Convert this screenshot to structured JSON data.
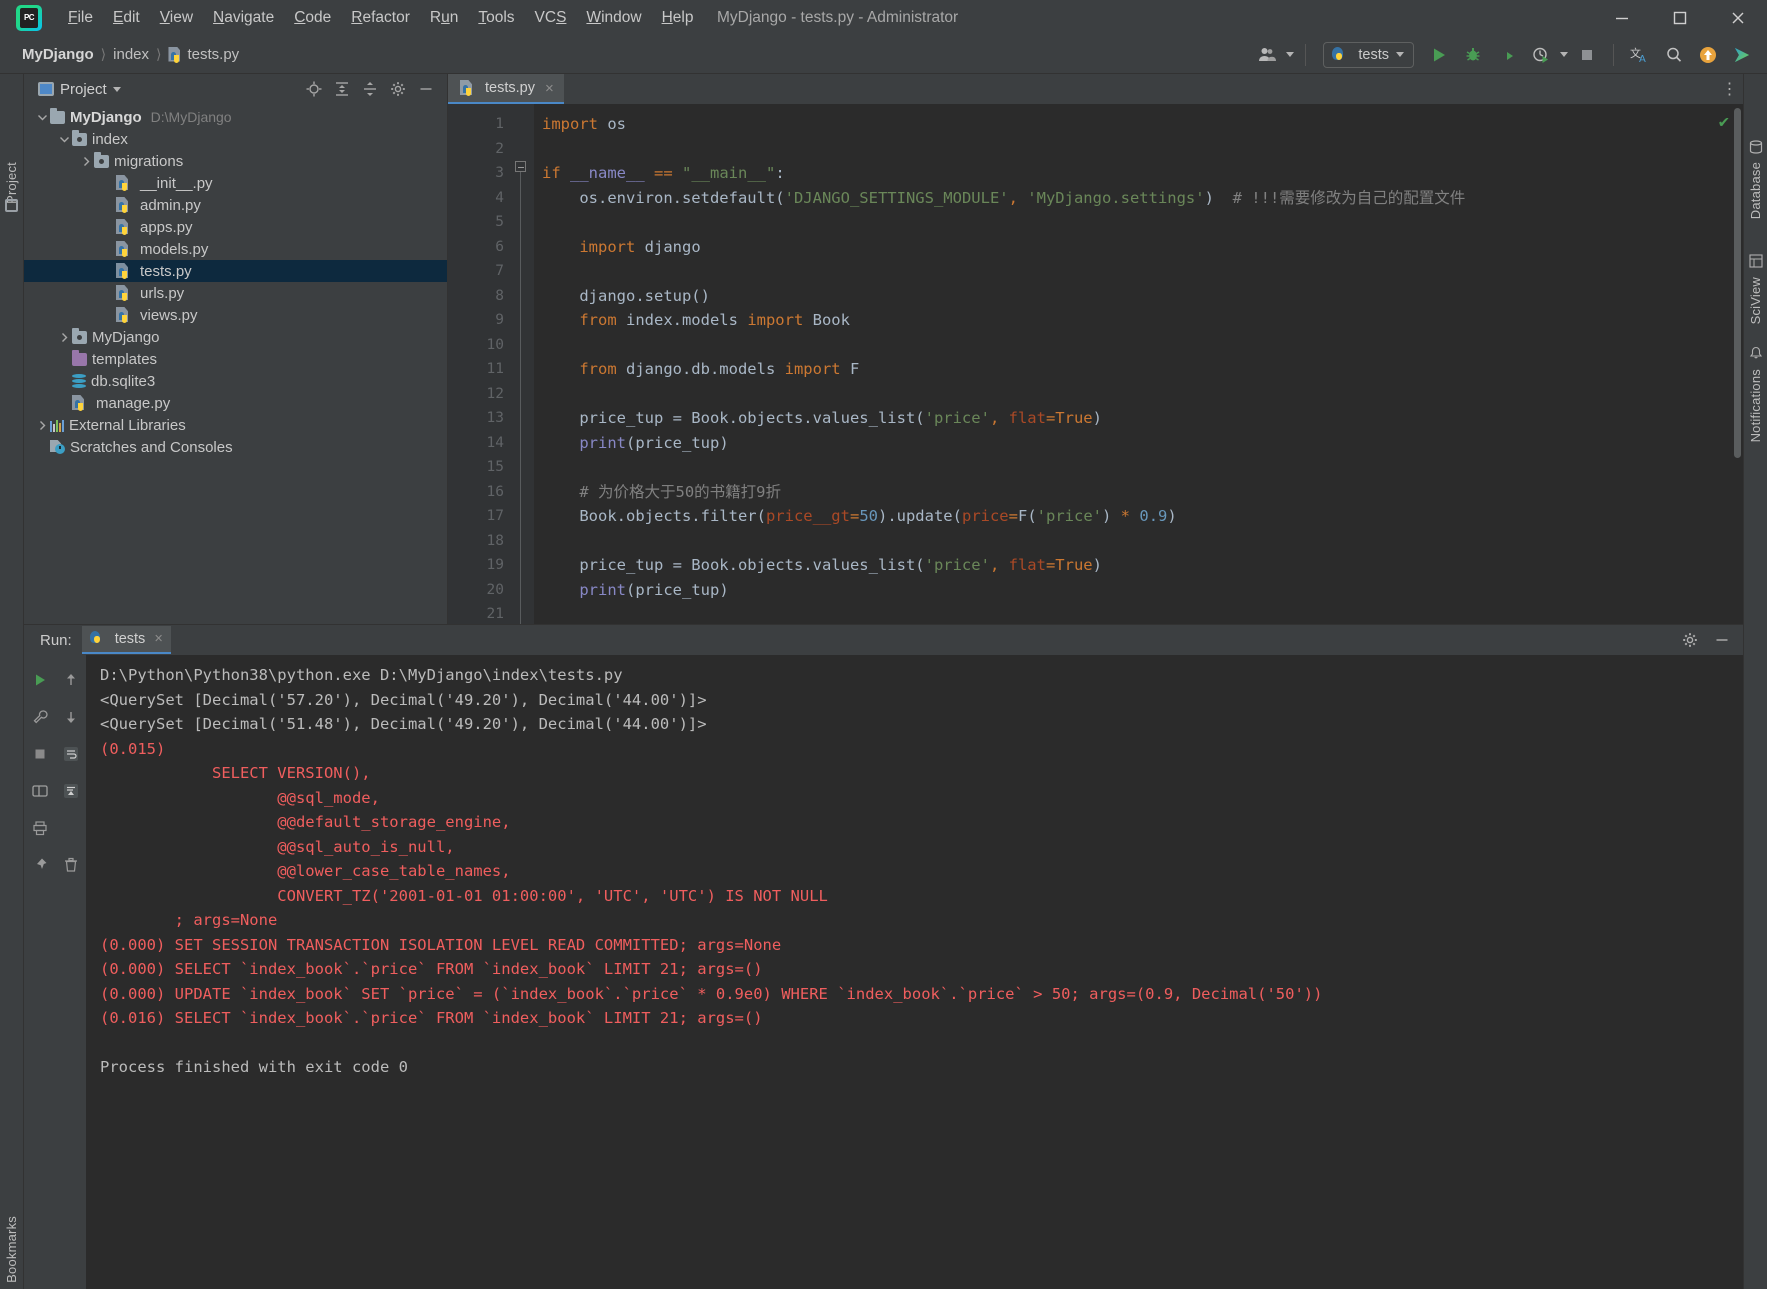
{
  "window": {
    "title": "MyDjango - tests.py - Administrator",
    "minimize": "minimize-icon",
    "maximize": "maximize-icon",
    "close": "close-icon"
  },
  "menu": {
    "logo_text": "PC",
    "items": [
      {
        "label": "File",
        "mnemonic": "F"
      },
      {
        "label": "Edit",
        "mnemonic": "E"
      },
      {
        "label": "View",
        "mnemonic": "V"
      },
      {
        "label": "Navigate",
        "mnemonic": "N"
      },
      {
        "label": "Code",
        "mnemonic": "C"
      },
      {
        "label": "Refactor",
        "mnemonic": "R"
      },
      {
        "label": "Run",
        "mnemonic": "u"
      },
      {
        "label": "Tools",
        "mnemonic": "T"
      },
      {
        "label": "VCS",
        "mnemonic": "S"
      },
      {
        "label": "Window",
        "mnemonic": "W"
      },
      {
        "label": "Help",
        "mnemonic": "H"
      }
    ]
  },
  "breadcrumbs": [
    {
      "label": "MyDjango",
      "bold": true,
      "icon": null
    },
    {
      "label": "index",
      "bold": false,
      "icon": null
    },
    {
      "label": "tests.py",
      "bold": false,
      "icon": "python-file-icon"
    }
  ],
  "toolbar": {
    "user_icon": "user-avatar-icon",
    "run_config_name": "tests",
    "run_config_icon": "python-icon",
    "run_label": "run-icon",
    "debug_label": "debug-icon",
    "coverage_label": "run-with-coverage-icon",
    "profile_label": "profile-icon",
    "stop_label": "stop-icon",
    "translate_label": "translate-icon",
    "search_label": "search-icon",
    "update_label": "update-icon",
    "play_label": "play-brand-icon"
  },
  "rails": {
    "left": [
      "Project",
      "Bookmarks"
    ],
    "right": [
      "Database",
      "SciView",
      "Notifications"
    ]
  },
  "project_panel": {
    "title": "Project",
    "tools": [
      "locate-icon",
      "expand-all-icon",
      "collapse-all-icon",
      "settings-icon",
      "hide-icon"
    ],
    "tree": [
      {
        "label": "MyDjango",
        "path": "D:\\MyDjango",
        "indent": 0,
        "icon": "folder-icon",
        "arrow": "down",
        "bold": true,
        "selected": false
      },
      {
        "label": "index",
        "path": "",
        "indent": 1,
        "icon": "module-folder-icon",
        "arrow": "down",
        "bold": false,
        "selected": false
      },
      {
        "label": "migrations",
        "path": "",
        "indent": 2,
        "icon": "module-folder-icon",
        "arrow": "right",
        "bold": false,
        "selected": false
      },
      {
        "label": "__init__.py",
        "path": "",
        "indent": 3,
        "icon": "python-file-icon",
        "arrow": "none",
        "bold": false,
        "selected": false
      },
      {
        "label": "admin.py",
        "path": "",
        "indent": 3,
        "icon": "python-file-icon",
        "arrow": "none",
        "bold": false,
        "selected": false
      },
      {
        "label": "apps.py",
        "path": "",
        "indent": 3,
        "icon": "python-file-icon",
        "arrow": "none",
        "bold": false,
        "selected": false
      },
      {
        "label": "models.py",
        "path": "",
        "indent": 3,
        "icon": "python-file-icon",
        "arrow": "none",
        "bold": false,
        "selected": false
      },
      {
        "label": "tests.py",
        "path": "",
        "indent": 3,
        "icon": "python-file-icon",
        "arrow": "none",
        "bold": false,
        "selected": true
      },
      {
        "label": "urls.py",
        "path": "",
        "indent": 3,
        "icon": "python-file-icon",
        "arrow": "none",
        "bold": false,
        "selected": false
      },
      {
        "label": "views.py",
        "path": "",
        "indent": 3,
        "icon": "python-file-icon",
        "arrow": "none",
        "bold": false,
        "selected": false
      },
      {
        "label": "MyDjango",
        "path": "",
        "indent": 1,
        "icon": "module-folder-icon",
        "arrow": "right",
        "bold": false,
        "selected": false
      },
      {
        "label": "templates",
        "path": "",
        "indent": 1,
        "icon": "templates-folder-icon",
        "arrow": "none",
        "bold": false,
        "selected": false
      },
      {
        "label": "db.sqlite3",
        "path": "",
        "indent": 1,
        "icon": "database-file-icon",
        "arrow": "none",
        "bold": false,
        "selected": false
      },
      {
        "label": "manage.py",
        "path": "",
        "indent": 1,
        "icon": "python-file-icon",
        "arrow": "none",
        "bold": false,
        "selected": false
      },
      {
        "label": "External Libraries",
        "path": "",
        "indent": 0,
        "icon": "libraries-icon",
        "arrow": "right",
        "bold": false,
        "selected": false
      },
      {
        "label": "Scratches and Consoles",
        "path": "",
        "indent": 0,
        "icon": "scratches-icon",
        "arrow": "none",
        "bold": false,
        "selected": false
      }
    ]
  },
  "editor": {
    "tabs": [
      {
        "label": "tests.py",
        "icon": "python-file-icon",
        "close": "×",
        "active": true
      }
    ],
    "more_icon": "more-options-icon",
    "inspection_status": "✔",
    "line_numbers": [
      "1",
      "2",
      "3",
      "4",
      "5",
      "6",
      "7",
      "8",
      "9",
      "10",
      "11",
      "12",
      "13",
      "14",
      "15",
      "16",
      "17",
      "18",
      "19",
      "20",
      "21"
    ],
    "lines": [
      {
        "n": 1,
        "tokens": [
          {
            "t": "import",
            "c": "kw"
          },
          {
            "t": " os",
            "c": "fn"
          }
        ]
      },
      {
        "n": 2,
        "tokens": []
      },
      {
        "n": 3,
        "tokens": [
          {
            "t": "if",
            "c": "kw"
          },
          {
            "t": " __name__ ",
            "c": "bi"
          },
          {
            "t": "==",
            "c": "kw"
          },
          {
            "t": " ",
            "c": "fn"
          },
          {
            "t": "\"__main__\"",
            "c": "str"
          },
          {
            "t": ":",
            "c": "fn"
          }
        ]
      },
      {
        "n": 4,
        "tokens": [
          {
            "t": "    os.environ.setdefault(",
            "c": "fn"
          },
          {
            "t": "'DJANGO_SETTINGS_MODULE'",
            "c": "str"
          },
          {
            "t": ",",
            "c": "kw"
          },
          {
            "t": " ",
            "c": "fn"
          },
          {
            "t": "'MyDjango.settings'",
            "c": "str"
          },
          {
            "t": ")",
            "c": "fn"
          },
          {
            "t": "  # !!!需要修改为自己的配置文件",
            "c": "cmt"
          }
        ]
      },
      {
        "n": 5,
        "tokens": []
      },
      {
        "n": 6,
        "tokens": [
          {
            "t": "    ",
            "c": "fn"
          },
          {
            "t": "import",
            "c": "kw"
          },
          {
            "t": " django",
            "c": "fn"
          }
        ]
      },
      {
        "n": 7,
        "tokens": []
      },
      {
        "n": 8,
        "tokens": [
          {
            "t": "    django.setup()",
            "c": "fn"
          }
        ]
      },
      {
        "n": 9,
        "tokens": [
          {
            "t": "    ",
            "c": "fn"
          },
          {
            "t": "from",
            "c": "kw"
          },
          {
            "t": " index.models ",
            "c": "fn"
          },
          {
            "t": "import",
            "c": "kw"
          },
          {
            "t": " Book",
            "c": "fn"
          }
        ]
      },
      {
        "n": 10,
        "tokens": []
      },
      {
        "n": 11,
        "tokens": [
          {
            "t": "    ",
            "c": "fn"
          },
          {
            "t": "from",
            "c": "kw"
          },
          {
            "t": " django.db.models ",
            "c": "fn"
          },
          {
            "t": "import",
            "c": "kw"
          },
          {
            "t": " F",
            "c": "fn"
          }
        ]
      },
      {
        "n": 12,
        "tokens": []
      },
      {
        "n": 13,
        "tokens": [
          {
            "t": "    price_tup = Book.objects.values_list(",
            "c": "fn"
          },
          {
            "t": "'price'",
            "c": "str"
          },
          {
            "t": ",",
            "c": "kw"
          },
          {
            "t": " ",
            "c": "fn"
          },
          {
            "t": "flat",
            "c": "param"
          },
          {
            "t": "=",
            "c": "kw"
          },
          {
            "t": "True",
            "c": "kw"
          },
          {
            "t": ")",
            "c": "fn"
          }
        ]
      },
      {
        "n": 14,
        "tokens": [
          {
            "t": "    ",
            "c": "fn"
          },
          {
            "t": "print",
            "c": "bi"
          },
          {
            "t": "(price_tup)",
            "c": "fn"
          }
        ]
      },
      {
        "n": 15,
        "tokens": []
      },
      {
        "n": 16,
        "tokens": [
          {
            "t": "    # 为价格大于50的书籍打9折",
            "c": "cmt"
          }
        ]
      },
      {
        "n": 17,
        "tokens": [
          {
            "t": "    Book.objects.filter(",
            "c": "fn"
          },
          {
            "t": "price__gt",
            "c": "param"
          },
          {
            "t": "=",
            "c": "kw"
          },
          {
            "t": "50",
            "c": "num"
          },
          {
            "t": ").update(",
            "c": "fn"
          },
          {
            "t": "price",
            "c": "param"
          },
          {
            "t": "=",
            "c": "kw"
          },
          {
            "t": "F(",
            "c": "fn"
          },
          {
            "t": "'price'",
            "c": "str"
          },
          {
            "t": ") ",
            "c": "fn"
          },
          {
            "t": "*",
            "c": "kw"
          },
          {
            "t": " ",
            "c": "fn"
          },
          {
            "t": "0.9",
            "c": "num"
          },
          {
            "t": ")",
            "c": "fn"
          }
        ]
      },
      {
        "n": 18,
        "tokens": []
      },
      {
        "n": 19,
        "tokens": [
          {
            "t": "    price_tup = Book.objects.values_list(",
            "c": "fn"
          },
          {
            "t": "'price'",
            "c": "str"
          },
          {
            "t": ",",
            "c": "kw"
          },
          {
            "t": " ",
            "c": "fn"
          },
          {
            "t": "flat",
            "c": "param"
          },
          {
            "t": "=",
            "c": "kw"
          },
          {
            "t": "True",
            "c": "kw"
          },
          {
            "t": ")",
            "c": "fn"
          }
        ]
      },
      {
        "n": 20,
        "tokens": [
          {
            "t": "    ",
            "c": "fn"
          },
          {
            "t": "print",
            "c": "bi"
          },
          {
            "t": "(price_tup)",
            "c": "fn"
          }
        ]
      },
      {
        "n": 21,
        "tokens": []
      }
    ]
  },
  "run_panel": {
    "label": "Run:",
    "tab": {
      "label": "tests",
      "icon": "python-icon",
      "close": "×"
    },
    "header_tools": [
      "settings-icon",
      "hide-icon"
    ],
    "rail_tools": [
      "rerun-icon",
      "up-arrow-icon",
      "wrench-icon",
      "down-arrow-icon",
      "stop-icon",
      "soft-wrap-icon",
      "layout-icon",
      "scroll-to-end-icon",
      "print-icon",
      "pin-icon",
      "trash-icon"
    ],
    "output": [
      {
        "text": "D:\\Python\\Python38\\python.exe D:\\MyDjango\\index\\tests.py",
        "error": false
      },
      {
        "text": "<QuerySet [Decimal('57.20'), Decimal('49.20'), Decimal('44.00')]>",
        "error": false
      },
      {
        "text": "<QuerySet [Decimal('51.48'), Decimal('49.20'), Decimal('44.00')]>",
        "error": false
      },
      {
        "text": "(0.015)",
        "error": true
      },
      {
        "text": "            SELECT VERSION(),",
        "error": true
      },
      {
        "text": "                   @@sql_mode,",
        "error": true
      },
      {
        "text": "                   @@default_storage_engine,",
        "error": true
      },
      {
        "text": "                   @@sql_auto_is_null,",
        "error": true
      },
      {
        "text": "                   @@lower_case_table_names,",
        "error": true
      },
      {
        "text": "                   CONVERT_TZ('2001-01-01 01:00:00', 'UTC', 'UTC') IS NOT NULL",
        "error": true
      },
      {
        "text": "        ; args=None",
        "error": true
      },
      {
        "text": "(0.000) SET SESSION TRANSACTION ISOLATION LEVEL READ COMMITTED; args=None",
        "error": true
      },
      {
        "text": "(0.000) SELECT `index_book`.`price` FROM `index_book` LIMIT 21; args=()",
        "error": true
      },
      {
        "text": "(0.000) UPDATE `index_book` SET `price` = (`index_book`.`price` * 0.9e0) WHERE `index_book`.`price` > 50; args=(0.9, Decimal('50'))",
        "error": true
      },
      {
        "text": "(0.016) SELECT `index_book`.`price` FROM `index_book` LIMIT 21; args=()",
        "error": true
      },
      {
        "text": "",
        "error": false
      },
      {
        "text": "Process finished with exit code 0",
        "error": false
      }
    ]
  },
  "colors": {
    "accent": "#4a88c7",
    "selection": "#0d293e",
    "error": "#f05e5e",
    "keyword": "#cc7832",
    "string": "#6a8759",
    "number": "#6897bb",
    "comment": "#808080",
    "editor_bg": "#2b2b2b",
    "panel_bg": "#3c3f41"
  }
}
